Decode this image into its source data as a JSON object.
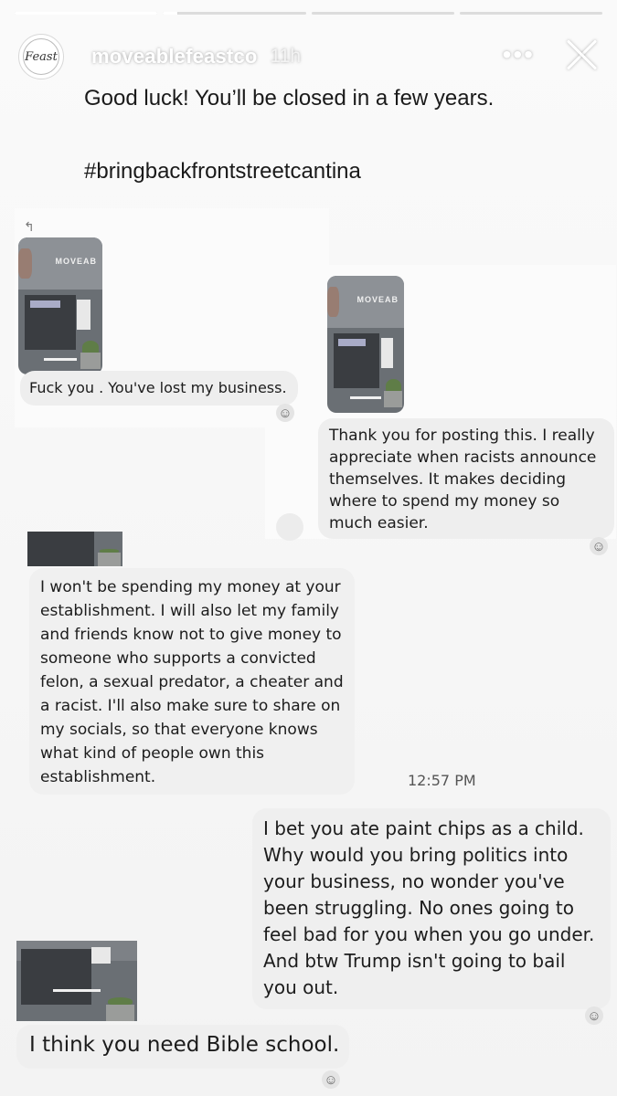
{
  "story": {
    "progress": [
      1,
      0.1,
      0,
      0
    ],
    "account": "moveablefeastco",
    "time": "11h",
    "avatar_text": "Feast",
    "more_icon": "•••",
    "caption_line1": "Good luck! You’ll be closed in a few years.",
    "caption_line2": "#bringbackfrontstreetcantina"
  },
  "photo_sign": "MOVEAB",
  "messages": [
    {
      "text": "Fuck you . You've lost my business."
    },
    {
      "text": "Thank you for posting this. I really appreciate when racists announce themselves. It makes deciding where to spend my money so much easier."
    },
    {
      "text": "I won't be spending my money at your establishment. I will also let my family and friends know not to give money to someone who supports a convicted felon, a sexual predator, a cheater and a racist. I'll also make sure to share on my socials, so that everyone knows what kind of people own this establishment."
    },
    {
      "text": "I bet you ate paint chips as a child. Why would you bring politics into your business, no wonder you've been struggling. No ones going to feel bad for you when you go under. And btw Trump isn't going to bail you out."
    },
    {
      "text": "I think you need Bible school."
    }
  ],
  "timestamp": "12:57 PM",
  "reaction_icon": "☺"
}
